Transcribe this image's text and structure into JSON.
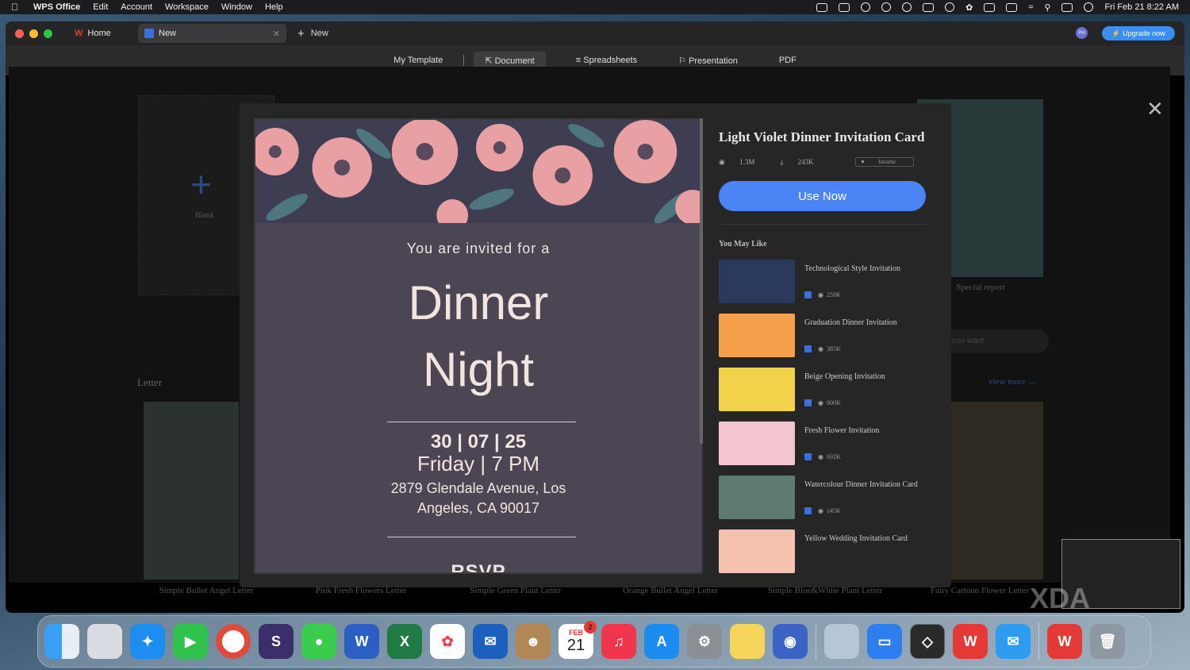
{
  "menubar": {
    "app": "WPS Office",
    "items": [
      "Edit",
      "Account",
      "Workspace",
      "Window",
      "Help"
    ],
    "clock": "Fri Feb 21  8:22 AM"
  },
  "tabs": {
    "home": "Home",
    "new_tab": "New",
    "new_button": "New"
  },
  "header": {
    "avatar": "PH",
    "upgrade": "Upgrade now"
  },
  "categories": [
    "My Template",
    "Document",
    "Spreadsheets",
    "Presentation",
    "PDF"
  ],
  "gallery": {
    "blank": "Blank",
    "section": "Letter",
    "view_more": "view more →",
    "side_card": "Special report",
    "search_hint": "you want",
    "letters": [
      "Simple Bullet Angel Letter",
      "Pink Fresh Flowers Letter",
      "Simple Green Plant Letter",
      "Orange Bullet Angel Letter",
      "Simple Blue&White Plant Letter",
      "Fairy Cartoon Flower Letter"
    ]
  },
  "preview": {
    "invited": "You are invited for a",
    "line1": "Dinner",
    "line2": "Night",
    "date": "30 | 07 | 25",
    "time": "Friday | 7 PM",
    "address": "2879 Glendale Avenue, Los Angeles, CA 90017",
    "rsvp": "RSVP"
  },
  "template": {
    "title": "Light Violet Dinner Invitation Card",
    "views": "1.3M",
    "downloads": "243K",
    "favorite": "favorite",
    "use_now": "Use Now",
    "you_may_like": "You May Like"
  },
  "recommendations": [
    {
      "title": "Technological Style Invitation",
      "views": "259K",
      "color": "#2a3a5c"
    },
    {
      "title": "Graduation Dinner Invitation",
      "views": "385K",
      "color": "#f4a04a"
    },
    {
      "title": "Beige Opening Invitation",
      "views": "800K",
      "color": "#f1d24a"
    },
    {
      "title": "Fresh Flower Invitation",
      "views": "692K",
      "color": "#f3c6cf"
    },
    {
      "title": "Watercolour Dinner Invitation Card",
      "views": "145K",
      "color": "#5f7a72"
    },
    {
      "title": "Yellow Wedding Invitation Card",
      "views": "",
      "color": "#f5c2b0"
    }
  ],
  "dock": {
    "calendar_month": "FEB",
    "calendar_day": "21",
    "calendar_badge": "2",
    "apps": [
      "finder-icon",
      "launchpad-icon",
      "safari-icon",
      "facetime-icon",
      "chrome-icon",
      "scrivener-icon",
      "messages-icon",
      "word-icon",
      "excel-icon",
      "photos-icon",
      "thunderbird-icon",
      "contacts-icon",
      "calendar-icon",
      "music-icon",
      "app-store-icon",
      "system-settings-icon",
      "notes-icon",
      "bitwarden-icon"
    ]
  },
  "watermark": "XDA",
  "colors": {
    "accent": "#4b84f4",
    "brand_red": "#e53935",
    "card_bg": "#4c4654"
  }
}
